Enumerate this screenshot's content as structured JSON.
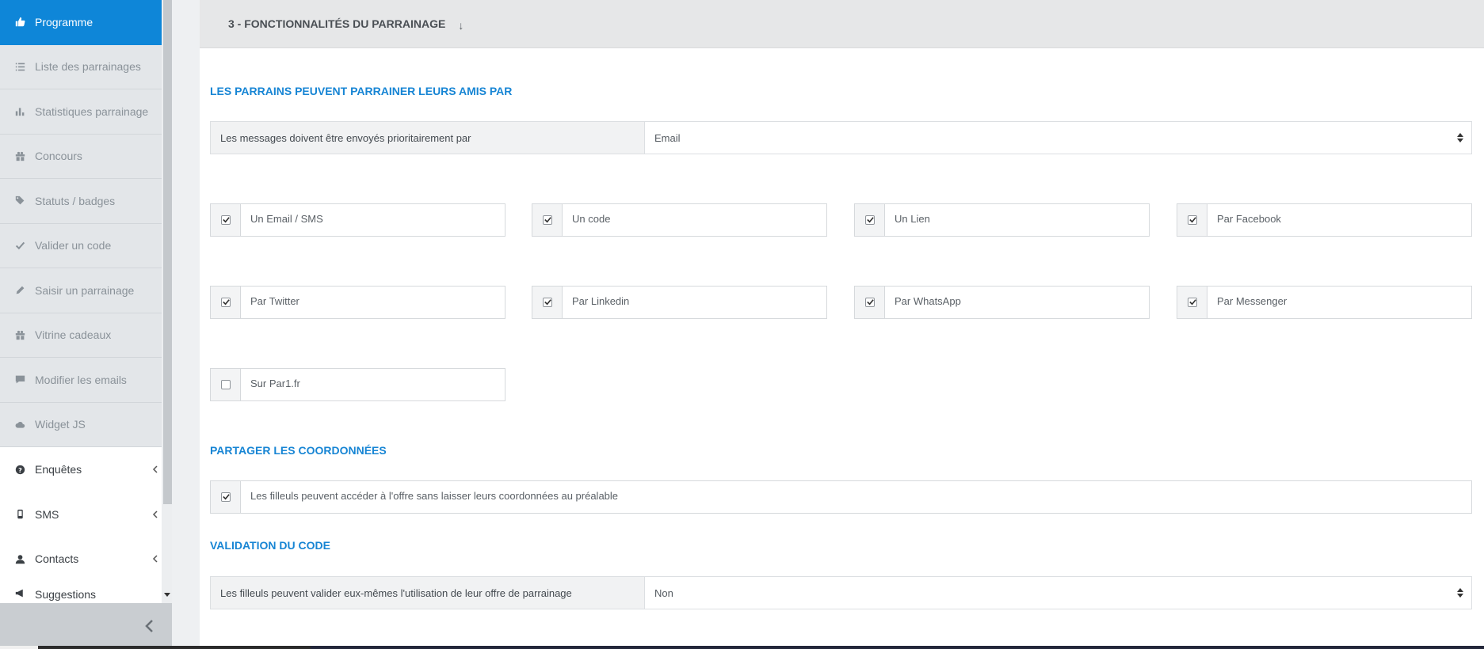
{
  "sidebar": {
    "items": [
      {
        "label": "Programme",
        "icon": "thumbs-up-icon",
        "state": "active"
      },
      {
        "label": "Liste des parrainages",
        "icon": "list-icon",
        "state": "default"
      },
      {
        "label": "Statistiques parrainage",
        "icon": "bar-chart-icon",
        "state": "default"
      },
      {
        "label": "Concours",
        "icon": "gift-icon",
        "state": "default"
      },
      {
        "label": "Statuts / badges",
        "icon": "tags-icon",
        "state": "default"
      },
      {
        "label": "Valider un code",
        "icon": "check-icon",
        "state": "default"
      },
      {
        "label": "Saisir un parrainage",
        "icon": "pencil-icon",
        "state": "default"
      },
      {
        "label": "Vitrine cadeaux",
        "icon": "gift-icon",
        "state": "default"
      },
      {
        "label": "Modifier les emails",
        "icon": "comment-icon",
        "state": "default"
      },
      {
        "label": "Widget JS",
        "icon": "cloud-icon",
        "state": "default"
      },
      {
        "label": "Enquêtes",
        "icon": "question-circle-icon",
        "state": "plain"
      },
      {
        "label": "SMS",
        "icon": "mobile-icon",
        "state": "plain"
      },
      {
        "label": "Contacts",
        "icon": "user-icon",
        "state": "plain"
      },
      {
        "label": "Suggestions",
        "icon": "megaphone-icon",
        "state": "plain"
      }
    ]
  },
  "colors": {
    "accent": "#0e86d8",
    "section_title": "#1785d4"
  },
  "panel": {
    "title": "3 - FONCTIONNALITÉS DU PARRAINAGE",
    "arrow": "↓"
  },
  "section1": {
    "title": "LES PARRAINS PEUVENT PARRAINER LEURS AMIS PAR",
    "priority_label": "Les messages doivent être envoyés prioritairement par",
    "priority_value": "Email",
    "options": [
      {
        "label": "Un Email / SMS",
        "checked": true
      },
      {
        "label": "Un code",
        "checked": true
      },
      {
        "label": "Un Lien",
        "checked": true
      },
      {
        "label": "Par Facebook",
        "checked": true
      },
      {
        "label": "Par Twitter",
        "checked": true
      },
      {
        "label": "Par Linkedin",
        "checked": true
      },
      {
        "label": "Par WhatsApp",
        "checked": true
      },
      {
        "label": "Par Messenger",
        "checked": true
      },
      {
        "label": "Sur Par1.fr",
        "checked": false
      }
    ]
  },
  "section2": {
    "title": "PARTAGER LES COORDONNÉES",
    "option": {
      "label": "Les filleuls peuvent accéder à l'offre sans laisser leurs coordonnées au préalable",
      "checked": true
    }
  },
  "section3": {
    "title": "VALIDATION DU CODE",
    "label": "Les filleuls peuvent valider eux-mêmes l'utilisation de leur offre de parrainage",
    "value": "Non"
  }
}
